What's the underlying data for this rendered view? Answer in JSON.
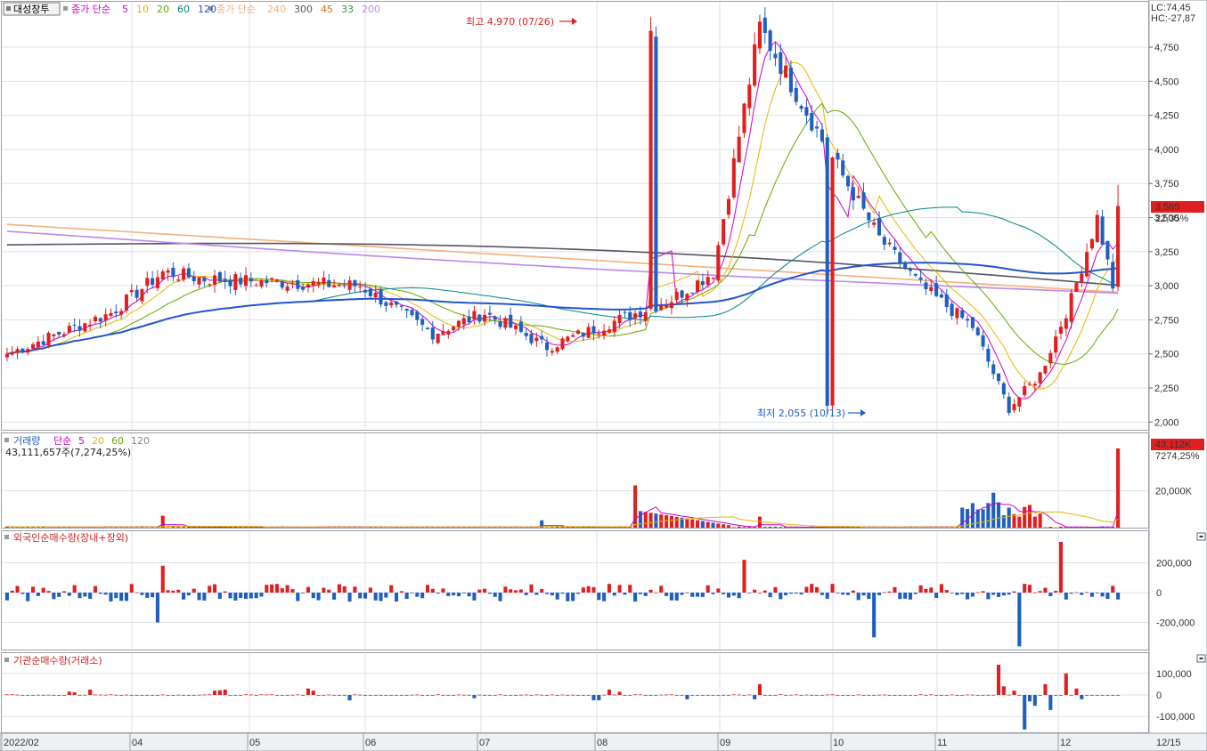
{
  "stock_name": "대성창투",
  "price_pane": {
    "ma_short_label": "종가 단순",
    "ma_short_periods": [
      "5",
      "10",
      "20",
      "60",
      "120"
    ],
    "ma_short_colors": [
      "#cc00cc",
      "#e6b800",
      "#66aa00",
      "#008888",
      "#2255cc"
    ],
    "ma_long_label": "종가 단순",
    "ma_long_periods": [
      "240",
      "300",
      "45",
      "33",
      "200"
    ],
    "ma_long_colors": [
      "#f5b07a",
      "#555566",
      "#e07020",
      "#229944",
      "#bb88ee"
    ],
    "lc_label": "LC:74,45",
    "hc_label": "HC:-27,87",
    "current_price": "3,585",
    "current_change": "22,35%",
    "high_annotation": "최고 4,970 (07/26)",
    "low_annotation": "최저 2,055 (10/13)"
  },
  "volume_pane": {
    "title": "거래량",
    "ma_label": "단순",
    "ma_periods": [
      "5",
      "20",
      "60",
      "120"
    ],
    "ma_colors": [
      "#cc00cc",
      "#e6b800",
      "#66aa00",
      "#888888"
    ],
    "info": "43,111,657주(7,274,25%)",
    "badge_value": "43,112K",
    "badge_pct": "7274,25%"
  },
  "foreign_pane": {
    "title": "외국인순매수량(장내+장외)"
  },
  "inst_pane": {
    "title": "기관순매수량(거래소)"
  },
  "x_axis_labels": [
    "2022/02",
    "04",
    "05",
    "06",
    "07",
    "08",
    "09",
    "10",
    "11",
    "12",
    "12/15"
  ],
  "colors": {
    "up": "#e02020",
    "down": "#1f5fbf",
    "badge": "#e02020"
  },
  "chart_data": [
    {
      "type": "candlestick",
      "title": "대성창투",
      "x_labels": [
        "2022/02",
        "04",
        "05",
        "06",
        "07",
        "08",
        "09",
        "10",
        "11",
        "12",
        "12/15"
      ],
      "y_ticks": [
        2000,
        2250,
        2500,
        2750,
        3000,
        3250,
        3500,
        3750,
        4000,
        4250,
        4500,
        4750
      ],
      "ylim": [
        1950,
        5070
      ],
      "grid": true,
      "anchors": [
        {
          "date": "2022-02",
          "close": 2500
        },
        {
          "date": "2022-03",
          "close": 2800
        },
        {
          "date": "2022-03-end",
          "close": 3100
        },
        {
          "date": "2022-04",
          "close": 3050
        },
        {
          "date": "2022-05",
          "close": 3000
        },
        {
          "date": "2022-05-mid",
          "close": 2650
        },
        {
          "date": "2022-06",
          "close": 2800
        },
        {
          "date": "2022-06-end",
          "close": 2550
        },
        {
          "date": "2022-07",
          "close": 2900
        },
        {
          "date": "2022-07-mid",
          "close": 3100
        },
        {
          "date": "2022-07-26",
          "close": 4900
        },
        {
          "date": "2022-08",
          "close": 4000
        },
        {
          "date": "2022-08-mid",
          "close": 3350
        },
        {
          "date": "2022-09",
          "close": 3000
        },
        {
          "date": "2022-09-mid",
          "close": 2700
        },
        {
          "date": "2022-10-13",
          "close": 2100
        },
        {
          "date": "2022-10-end",
          "close": 2350
        },
        {
          "date": "2022-11",
          "close": 2900
        },
        {
          "date": "2022-11-mid",
          "close": 3500
        },
        {
          "date": "2022-12",
          "close": 3000
        },
        {
          "date": "2022-12-14",
          "close": 2930
        },
        {
          "date": "2022-12-15",
          "close": 3585
        }
      ],
      "high": {
        "value": 4970,
        "date": "07/26"
      },
      "low": {
        "value": 2055,
        "date": "10/13"
      },
      "last": {
        "close": 3585,
        "change_pct": 22.35
      },
      "moving_averages": [
        "5",
        "10",
        "20",
        "60",
        "120",
        "240",
        "300",
        "45",
        "33",
        "200"
      ]
    },
    {
      "type": "bar",
      "title": "거래량",
      "y_ticks": [
        20000
      ],
      "y_tick_unit": "K",
      "last_value_k": 43112,
      "last_pct": 7274.25,
      "spikes": [
        {
          "date": "2022-03-end",
          "value_k": 6500
        },
        {
          "date": "2022-06-mid",
          "value_k": 4000
        },
        {
          "date": "2022-07-22",
          "value_k": 23000
        },
        {
          "date": "2022-08-mid",
          "value_k": 6000
        },
        {
          "date": "2022-11-mid",
          "value_k": 19000
        },
        {
          "date": "2022-12-15",
          "value_k": 43112
        }
      ]
    },
    {
      "type": "bar",
      "title": "외국인순매수량(장내+장외)",
      "y_ticks": [
        200000,
        0,
        -200000
      ],
      "ylim": [
        -370000,
        370000
      ],
      "extremes": [
        {
          "date": "2022-09-mid",
          "value": -300000
        },
        {
          "date": "2022-11-mid",
          "value": 340000
        },
        {
          "date": "2022-11",
          "value": -360000
        }
      ]
    },
    {
      "type": "bar",
      "title": "기관순매수량(거래소)",
      "y_ticks": [
        100000,
        0,
        -100000
      ],
      "ylim": [
        -165000,
        165000
      ],
      "extremes": [
        {
          "date": "2022-11",
          "value": 140000
        },
        {
          "date": "2022-11",
          "value": -160000
        }
      ]
    }
  ]
}
